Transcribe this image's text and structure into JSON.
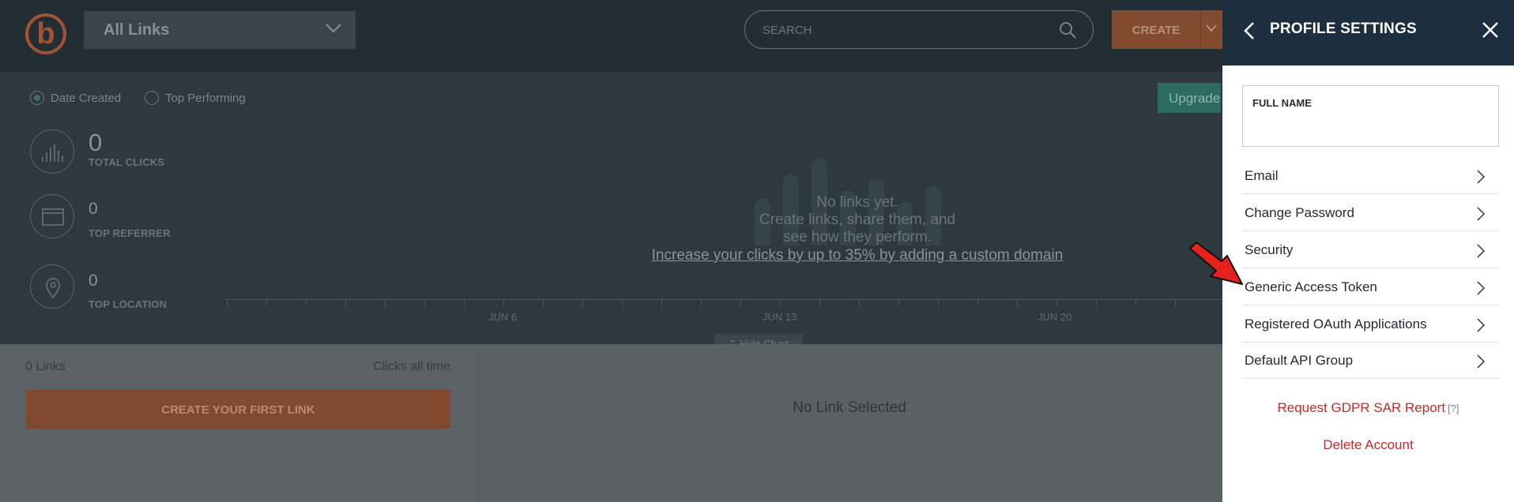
{
  "header": {
    "logo_letter": "b",
    "links_filter": "All Links",
    "search_placeholder": "SEARCH",
    "create_label": "CREATE"
  },
  "chart_area": {
    "sort_options": [
      {
        "label": "Date Created",
        "selected": true
      },
      {
        "label": "Top Performing",
        "selected": false
      }
    ],
    "upgrade_label": "Upgrade",
    "stats": [
      {
        "value": "0",
        "label": "TOTAL CLICKS",
        "icon": "bar-chart-icon"
      },
      {
        "value": "0",
        "label": "TOP REFERRER",
        "icon": "browser-window-icon"
      },
      {
        "value": "0",
        "label": "TOP LOCATION",
        "icon": "location-pin-icon"
      }
    ],
    "empty_lines": [
      "No links yet.",
      "Create links, share them, and",
      "see how they perform."
    ],
    "promo_link": "Increase your clicks by up to 35% by adding a custom domain",
    "axis_labels": [
      "JUN 6",
      "JUN 13",
      "JUN 20"
    ],
    "hide_chart_label": "Hide Chart"
  },
  "list": {
    "links_count": "0 Links",
    "clicks_all_time": "Clicks all time",
    "create_first_link": "CREATE YOUR FIRST LINK",
    "no_link_selected": "No Link Selected"
  },
  "profile_panel": {
    "title": "PROFILE SETTINGS",
    "full_name_label": "FULL NAME",
    "full_name_value": "",
    "menu_items": [
      "Email",
      "Change Password",
      "Security",
      "Generic Access Token",
      "Registered OAuth Applications",
      "Default API Group"
    ],
    "gdpr_label": "Request GDPR SAR Report",
    "gdpr_help": "[?]",
    "delete_account": "Delete Account"
  },
  "colors": {
    "brand_orange": "#ee6123",
    "panel_header": "#1d2f3e",
    "danger_red": "#c22b26",
    "annotation_arrow": "#e8211c"
  }
}
